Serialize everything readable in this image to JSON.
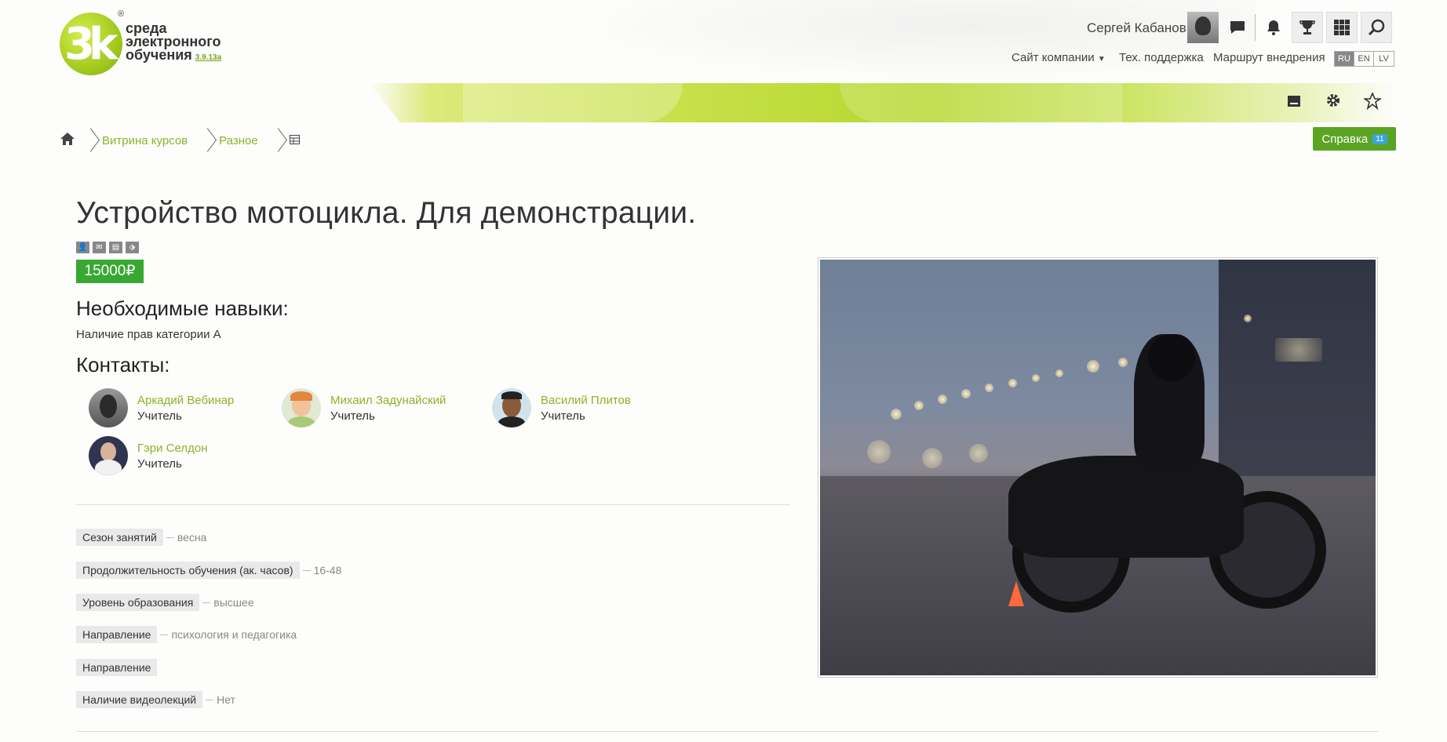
{
  "logo": {
    "line1": "среда",
    "line2": "электронного",
    "line3": "обучения",
    "version": "3.9.13a",
    "mark": "3k",
    "reg": "®"
  },
  "header": {
    "user_name": "Сергей Кабанов",
    "links": [
      "Сайт компании",
      "Тех. поддержка",
      "Маршрут внедрения"
    ],
    "languages": [
      "RU",
      "EN",
      "LV"
    ],
    "active_language": "RU",
    "icons": [
      "chat-icon",
      "bell-icon",
      "trophy-icon",
      "apps-grid-icon",
      "search-icon"
    ],
    "tools": [
      "card-icon",
      "gear-icon",
      "star-icon"
    ],
    "accent": "#b6d72d"
  },
  "breadcrumbs": {
    "items": [
      "Витрина курсов",
      "Разное"
    ]
  },
  "help": {
    "label": "Справка",
    "count": "11"
  },
  "course": {
    "title": "Устройство мотоцикла. Для демонстрации.",
    "price": "15000₽",
    "skills_heading": "Необходимые навыки:",
    "skills_text": "Наличие прав категории А",
    "contacts_heading": "Контакты:",
    "contacts": [
      {
        "name": "Аркадий Вебинар",
        "role": "Учитель"
      },
      {
        "name": "Михаил Задунайский",
        "role": "Учитель"
      },
      {
        "name": "Василий Плитов",
        "role": "Учитель"
      },
      {
        "name": "Гэри Селдон",
        "role": "Учитель"
      }
    ],
    "properties": [
      {
        "key": "Сезон занятий",
        "value": "весна"
      },
      {
        "key": "Продолжительность обучения (ак. часов)",
        "value": "16-48"
      },
      {
        "key": "Уровень образования",
        "value": "высшее"
      },
      {
        "key": "Направление",
        "value": "психология и педагогика"
      },
      {
        "key": "Направление",
        "value": ""
      },
      {
        "key": "Наличие видеолекций",
        "value": "Нет"
      }
    ]
  }
}
